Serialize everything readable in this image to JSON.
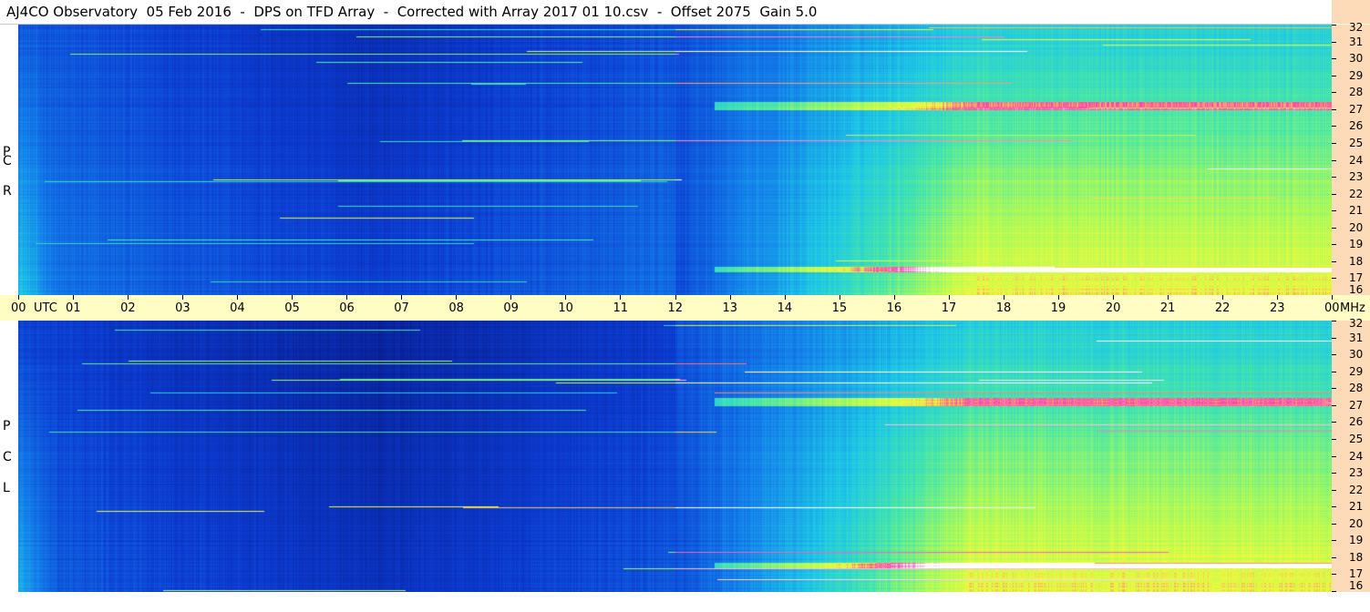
{
  "title": "AJ4CO Observatory  05 Feb 2016  -  DPS on TFD Array  -  Corrected with Array 2017 01 10.csv  -  Offset 2075  Gain 5.0",
  "chart_data": {
    "type": "heatmap",
    "title": "AJ4CO Observatory  05 Feb 2016  -  DPS on TFD Array  -  Corrected with Array 2017 01 10.csv  -  Offset 2075  Gain 5.0",
    "x_axis": {
      "unit_label": "UTC",
      "tick_labels": [
        "00",
        "01",
        "02",
        "03",
        "04",
        "05",
        "06",
        "07",
        "08",
        "09",
        "10",
        "11",
        "12",
        "13",
        "14",
        "15",
        "16",
        "17",
        "18",
        "19",
        "20",
        "21",
        "22",
        "23",
        "00"
      ],
      "range": [
        0,
        24
      ]
    },
    "y_axis": {
      "unit_label": "MHz",
      "tick_labels": [
        "32",
        "31",
        "30",
        "29",
        "28",
        "27",
        "26",
        "25",
        "24",
        "23",
        "22",
        "21",
        "20",
        "19",
        "18",
        "17",
        "16"
      ],
      "range": [
        16,
        32
      ]
    },
    "panels": [
      {
        "polarization": [
          "R",
          "C",
          "P"
        ]
      },
      {
        "polarization": [
          "L",
          "C",
          "P"
        ]
      }
    ]
  }
}
